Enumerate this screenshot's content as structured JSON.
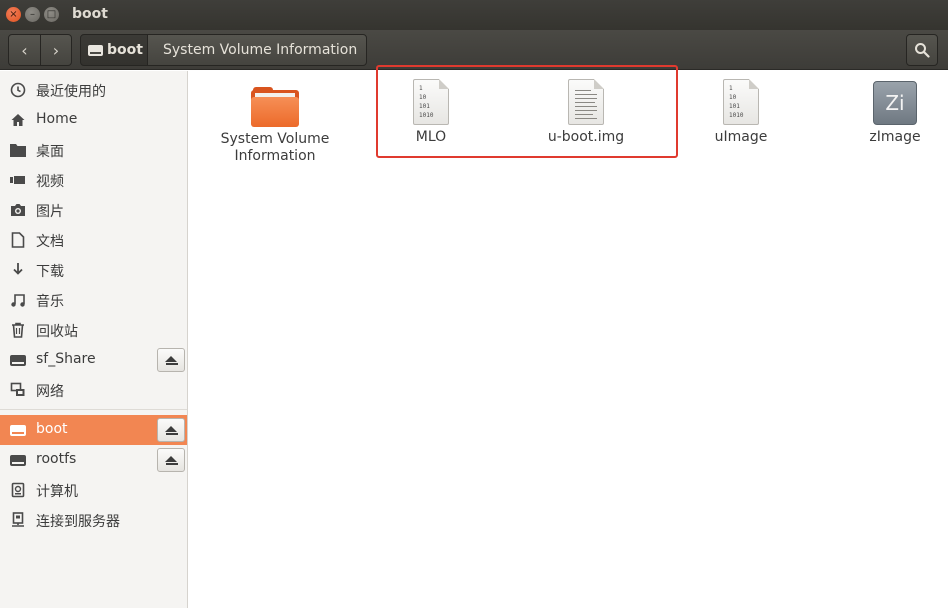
{
  "window": {
    "title": "boot",
    "close_glyph": "×",
    "min_glyph": "–",
    "max_glyph": "□"
  },
  "toolbar": {
    "back_glyph": "‹",
    "forward_glyph": "›",
    "path": [
      {
        "label": "boot",
        "icon": "drive-icon"
      },
      {
        "label": "System Volume Information"
      }
    ],
    "search_icon": "search-icon"
  },
  "sidebar": {
    "items": [
      {
        "label": "最近使用的",
        "icon": "clock-icon"
      },
      {
        "label": "Home",
        "icon": "home-icon"
      },
      {
        "label": "桌面",
        "icon": "desktop-folder-icon"
      },
      {
        "label": "视频",
        "icon": "video-icon"
      },
      {
        "label": "图片",
        "icon": "camera-icon"
      },
      {
        "label": "文档",
        "icon": "document-icon"
      },
      {
        "label": "下载",
        "icon": "download-icon"
      },
      {
        "label": "音乐",
        "icon": "music-icon"
      },
      {
        "label": "回收站",
        "icon": "trash-icon"
      },
      {
        "label": "sf_Share",
        "icon": "drive-icon",
        "eject": true
      },
      {
        "label": "网络",
        "icon": "network-icon"
      },
      {
        "label": "boot",
        "icon": "drive-icon",
        "eject": true,
        "active": true
      },
      {
        "label": "rootfs",
        "icon": "drive-icon",
        "eject": true
      },
      {
        "label": "计算机",
        "icon": "computer-icon"
      },
      {
        "label": "连接到服务器",
        "icon": "server-icon"
      }
    ]
  },
  "files": [
    {
      "name_line1": "System Volume",
      "name_line2": "Information",
      "type": "folder"
    },
    {
      "name_line1": "MLO",
      "type": "binary",
      "bin_text": "1\n10\n101\n1010"
    },
    {
      "name_line1": "u-boot.img",
      "type": "text-document"
    },
    {
      "name_line1": "uImage",
      "type": "binary",
      "bin_text": "1\n10\n101\n1010"
    },
    {
      "name_line1": "zImage",
      "type": "image",
      "badge": "Zi"
    }
  ],
  "colors": {
    "accent": "#f28652",
    "highlight_box": "#e03a2f",
    "folder": "#ec6a2a"
  }
}
